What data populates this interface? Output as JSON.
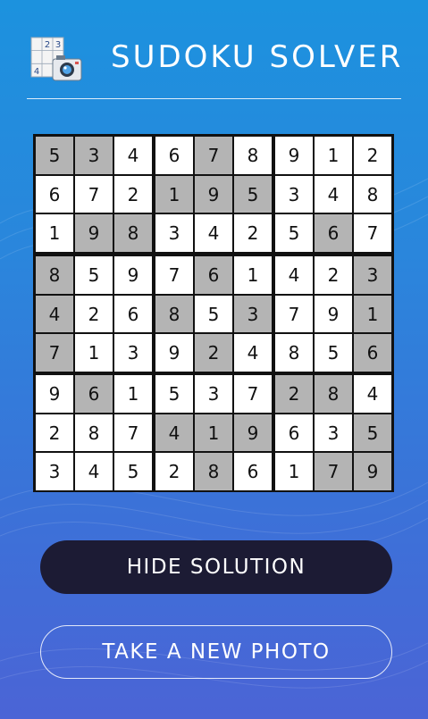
{
  "header": {
    "title": "SUDOKU SOLVER",
    "logo_icon": "sudoku-camera-icon"
  },
  "board": {
    "rows": [
      [
        "5",
        "3",
        "4",
        "6",
        "7",
        "8",
        "9",
        "1",
        "2"
      ],
      [
        "6",
        "7",
        "2",
        "1",
        "9",
        "5",
        "3",
        "4",
        "8"
      ],
      [
        "1",
        "9",
        "8",
        "3",
        "4",
        "2",
        "5",
        "6",
        "7"
      ],
      [
        "8",
        "5",
        "9",
        "7",
        "6",
        "1",
        "4",
        "2",
        "3"
      ],
      [
        "4",
        "2",
        "6",
        "8",
        "5",
        "3",
        "7",
        "9",
        "1"
      ],
      [
        "7",
        "1",
        "3",
        "9",
        "2",
        "4",
        "8",
        "5",
        "6"
      ],
      [
        "9",
        "6",
        "1",
        "5",
        "3",
        "7",
        "2",
        "8",
        "4"
      ],
      [
        "2",
        "8",
        "7",
        "4",
        "1",
        "9",
        "6",
        "3",
        "5"
      ],
      [
        "3",
        "4",
        "5",
        "2",
        "8",
        "6",
        "1",
        "7",
        "9"
      ]
    ],
    "given": [
      [
        1,
        1,
        0,
        0,
        1,
        0,
        0,
        0,
        0
      ],
      [
        0,
        0,
        0,
        1,
        1,
        1,
        0,
        0,
        0
      ],
      [
        0,
        1,
        1,
        0,
        0,
        0,
        0,
        1,
        0
      ],
      [
        1,
        0,
        0,
        0,
        1,
        0,
        0,
        0,
        1
      ],
      [
        1,
        0,
        0,
        1,
        0,
        1,
        0,
        0,
        1
      ],
      [
        1,
        0,
        0,
        0,
        1,
        0,
        0,
        0,
        1
      ],
      [
        0,
        1,
        0,
        0,
        0,
        0,
        1,
        1,
        0
      ],
      [
        0,
        0,
        0,
        1,
        1,
        1,
        0,
        0,
        1
      ],
      [
        0,
        0,
        0,
        0,
        1,
        0,
        0,
        1,
        1
      ]
    ],
    "given_color": "#b4b4b4",
    "empty_color": "#ffffff"
  },
  "buttons": {
    "hide_solution": "HIDE SOLUTION",
    "take_photo": "TAKE A NEW PHOTO"
  },
  "colors": {
    "button_dark": "#1c1b34",
    "background_top": "#1c92de",
    "background_bottom": "#4b64d6"
  }
}
